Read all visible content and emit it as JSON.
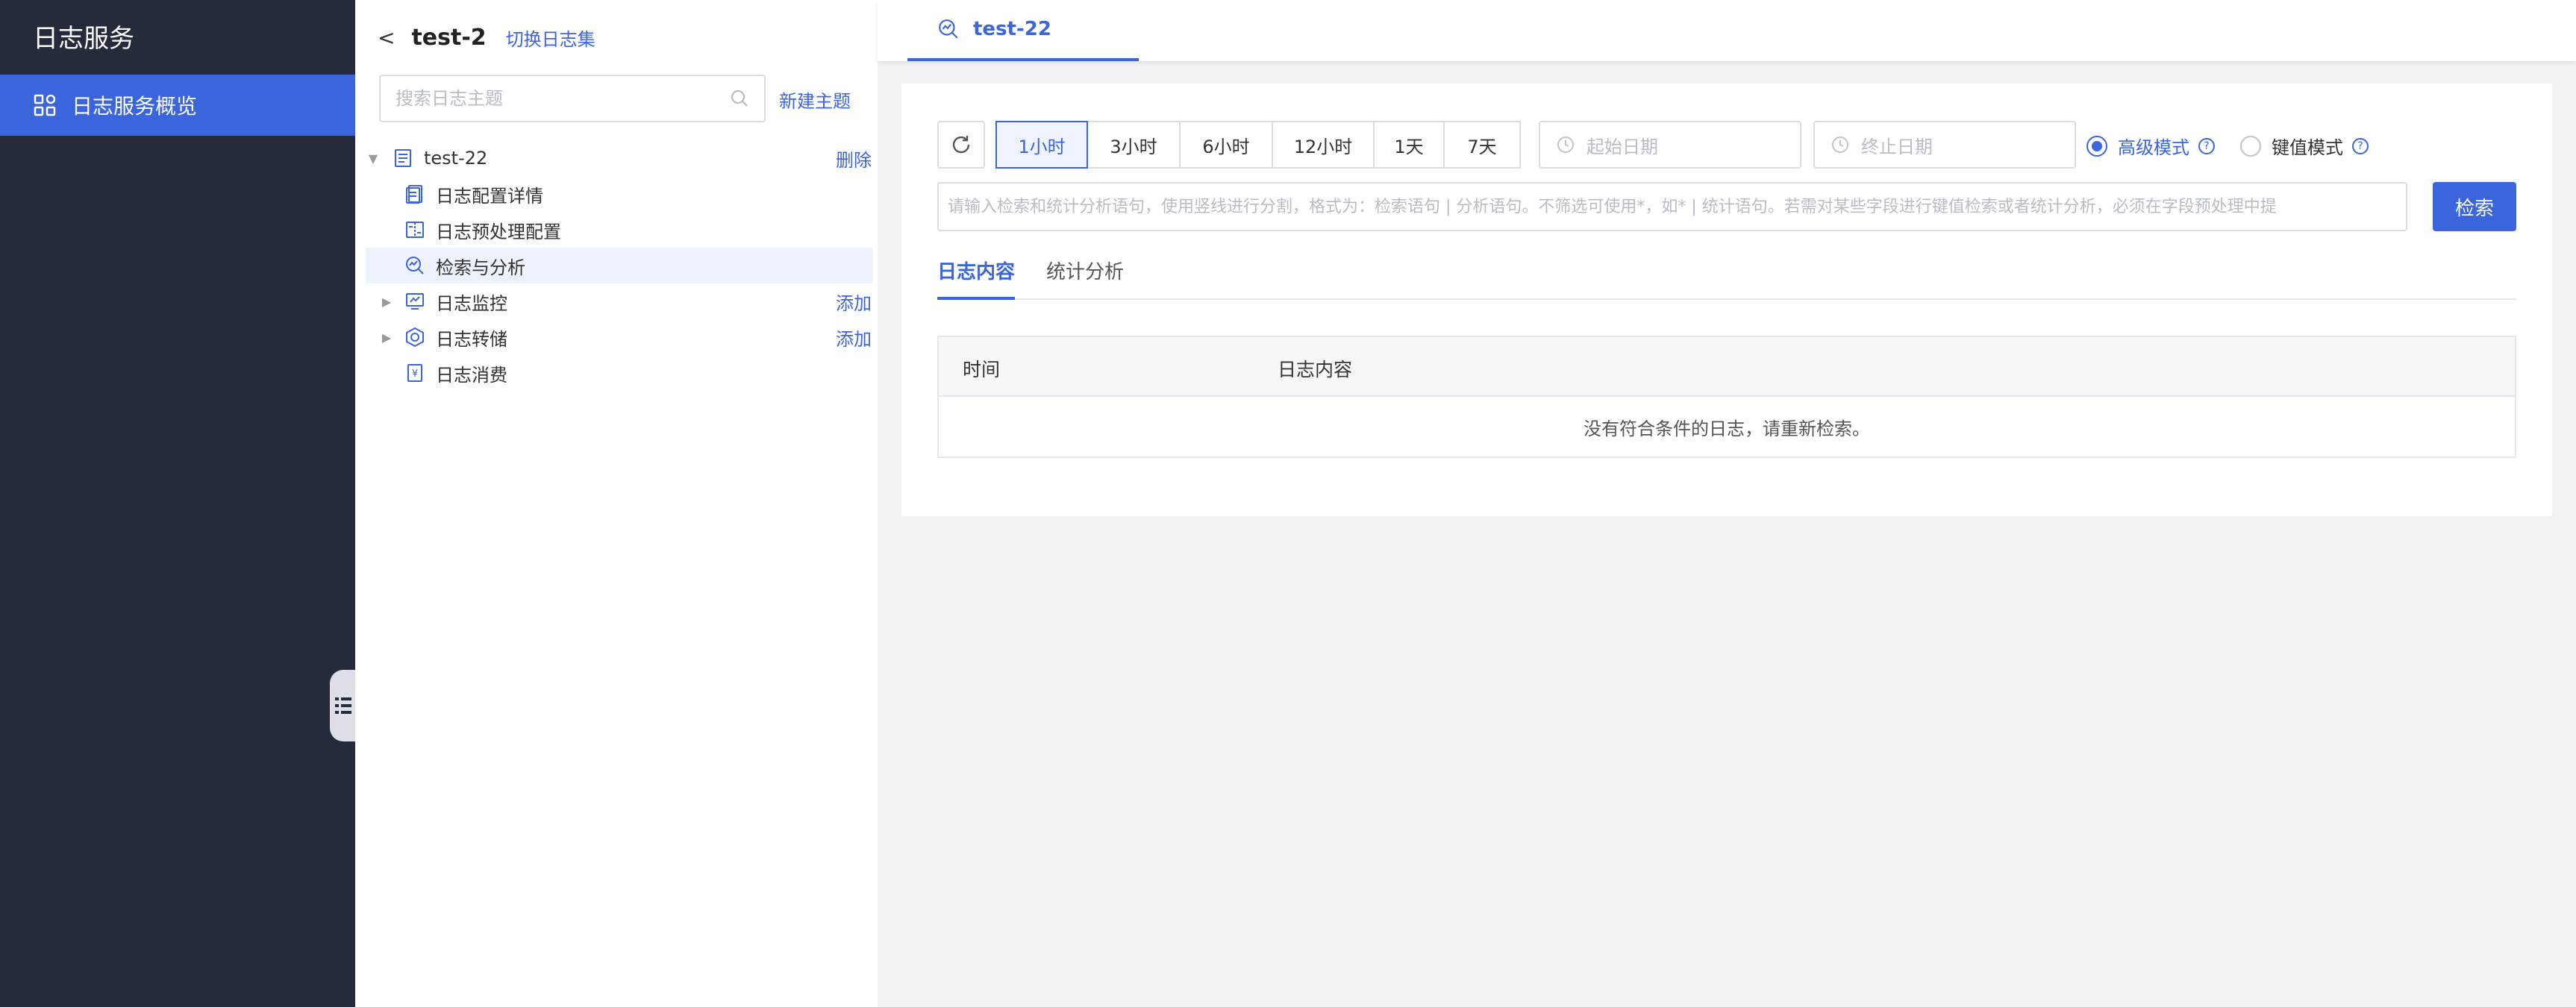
{
  "sidebar": {
    "title": "日志服务",
    "nav_item": "日志服务概览"
  },
  "tree_panel": {
    "back_glyph": "<",
    "logset_name": "test-2",
    "switch_logset": "切换日志集",
    "search_placeholder": "搜索日志主题",
    "new_topic": "新建主题",
    "topic": {
      "name": "test-22",
      "action": "删除"
    },
    "items": [
      {
        "label": "日志配置详情",
        "icon": "document-icon"
      },
      {
        "label": "日志预处理配置",
        "icon": "preprocess-icon"
      },
      {
        "label": "检索与分析",
        "icon": "search-analysis-icon",
        "selected": true
      },
      {
        "label": "日志监控",
        "icon": "monitor-icon",
        "expandable": true,
        "action": "添加"
      },
      {
        "label": "日志转储",
        "icon": "dump-icon",
        "expandable": true,
        "action": "添加"
      },
      {
        "label": "日志消费",
        "icon": "consume-icon"
      }
    ]
  },
  "main": {
    "tab": "test-22",
    "time_ranges": [
      "1小时",
      "3小时",
      "6小时",
      "12小时",
      "1天",
      "7天"
    ],
    "selected_time_range": "1小时",
    "start_date_placeholder": "起始日期",
    "end_date_placeholder": "终止日期",
    "modes": [
      "高级模式",
      "键值模式"
    ],
    "selected_mode": "高级模式",
    "help_glyph": "?",
    "query_placeholder": "请输入检索和统计分析语句，使用竖线进行分割，格式为：检索语句 | 分析语句。不筛选可使用*，如* | 统计语句。若需对某些字段进行键值检索或者统计分析，必须在字段预处理中提",
    "search_button": "检索",
    "sub_tabs": [
      "日志内容",
      "统计分析"
    ],
    "active_sub_tab": "日志内容",
    "table": {
      "columns": [
        "时间",
        "日志内容"
      ],
      "empty_text": "没有符合条件的日志，请重新检索。"
    }
  },
  "colors": {
    "accent": "#3b65dc",
    "sidebar_bg": "#252b3a"
  }
}
